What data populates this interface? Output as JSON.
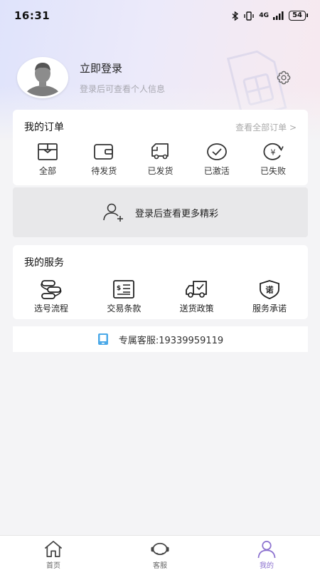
{
  "status_bar": {
    "time": "16:31",
    "network": "4G",
    "battery": "54"
  },
  "profile": {
    "title": "立即登录",
    "subtitle": "登录后可查看个人信息"
  },
  "orders": {
    "title": "我的订单",
    "view_all": "查看全部订单 >",
    "items": [
      {
        "label": "全部",
        "icon": "box-icon"
      },
      {
        "label": "待发货",
        "icon": "wallet-icon"
      },
      {
        "label": "已发货",
        "icon": "truck-icon"
      },
      {
        "label": "已激活",
        "icon": "check-circle-icon"
      },
      {
        "label": "已失败",
        "icon": "yen-refresh-icon"
      }
    ]
  },
  "promo": {
    "text": "登录后查看更多精彩"
  },
  "services": {
    "title": "我的服务",
    "items": [
      {
        "label": "选号流程",
        "icon": "flow-icon"
      },
      {
        "label": "交易条款",
        "icon": "terms-icon"
      },
      {
        "label": "送货政策",
        "icon": "delivery-icon"
      },
      {
        "label": "服务承诺",
        "icon": "promise-shield-icon"
      }
    ]
  },
  "hotline": {
    "text": "专属客服:19339959119"
  },
  "tabbar": {
    "items": [
      {
        "label": "首页",
        "icon": "home-icon"
      },
      {
        "label": "客服",
        "icon": "headset-icon"
      },
      {
        "label": "我的",
        "icon": "user-icon",
        "active": true
      }
    ]
  },
  "colors": {
    "accent": "#8c72cf",
    "promo_bg": "#e8e8ea",
    "phone_icon": "#4ba9e8"
  }
}
